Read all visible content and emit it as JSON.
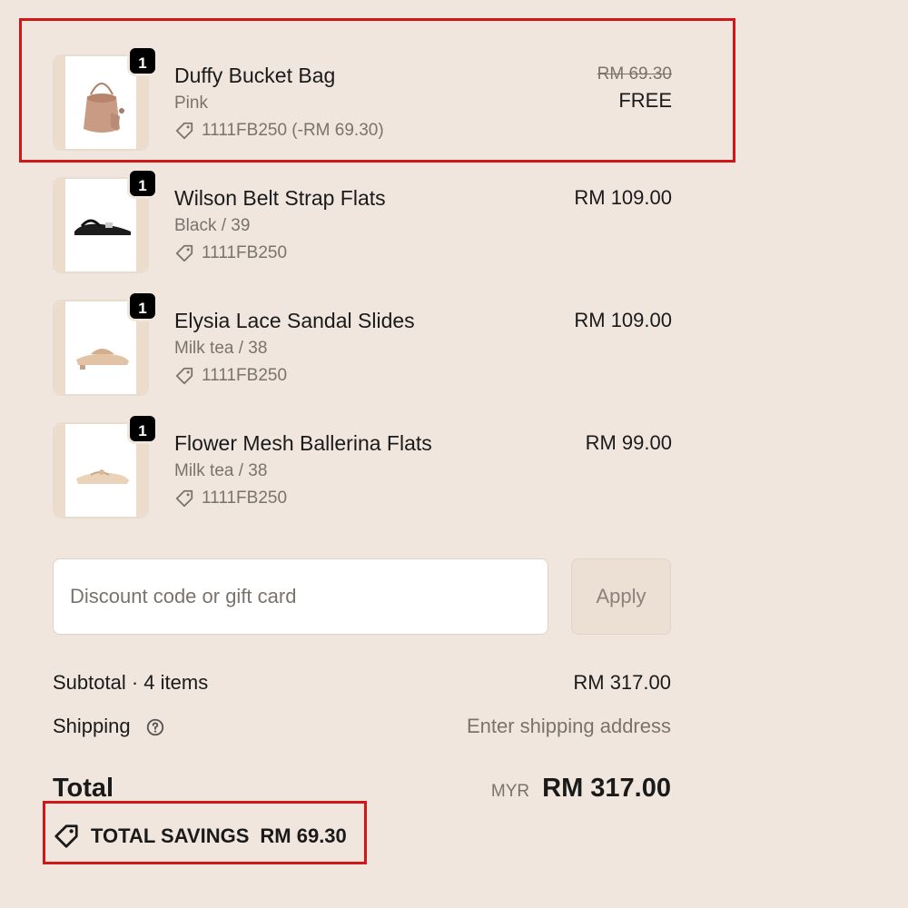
{
  "items": [
    {
      "qty": "1",
      "name": "Duffy Bucket Bag",
      "variant": "Pink",
      "code": "1111FB250 (-RM 69.30)",
      "old_price": "RM 69.30",
      "price": "FREE",
      "icon": "tag-icon"
    },
    {
      "qty": "1",
      "name": "Wilson Belt Strap Flats",
      "variant": "Black / 39",
      "code": "1111FB250",
      "price": "RM 109.00",
      "icon": "tag-icon"
    },
    {
      "qty": "1",
      "name": "Elysia Lace Sandal Slides",
      "variant": "Milk tea / 38",
      "code": "1111FB250",
      "price": "RM 109.00",
      "icon": "tag-icon"
    },
    {
      "qty": "1",
      "name": "Flower Mesh Ballerina Flats",
      "variant": "Milk tea / 38",
      "code": "1111FB250",
      "price": "RM 99.00",
      "icon": "tag-icon"
    }
  ],
  "discount": {
    "placeholder": "Discount code or gift card",
    "apply_label": "Apply"
  },
  "summary": {
    "subtotal_label": "Subtotal · 4 items",
    "subtotal_value": "RM 317.00",
    "shipping_label": "Shipping",
    "shipping_value": "Enter shipping address",
    "total_label": "Total",
    "currency": "MYR",
    "total_value": "RM 317.00",
    "savings_label": "TOTAL SAVINGS",
    "savings_value": "RM 69.30"
  },
  "colors": {
    "highlight": "#d01818",
    "background": "#f0e6de"
  }
}
